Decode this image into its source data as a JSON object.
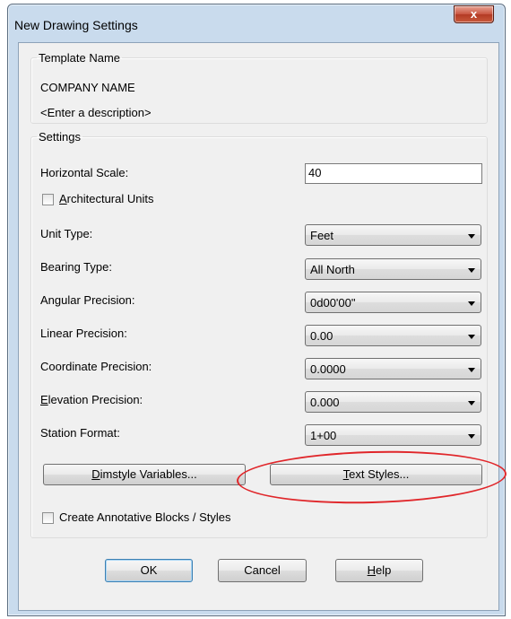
{
  "window": {
    "title": "New Drawing Settings",
    "close_glyph": "x"
  },
  "template_group": {
    "legend": "Template Name",
    "name": "COMPANY NAME",
    "description": "<Enter a description>"
  },
  "settings": {
    "legend": "Settings",
    "horizontal_scale": {
      "label": "Horizontal Scale:",
      "value": "40"
    },
    "architectural_units": {
      "label_prefix": "",
      "label_accel": "A",
      "label_rest": "rchitectural Units",
      "checked": false
    },
    "unit_type": {
      "label": "Unit Type:",
      "value": "Feet"
    },
    "bearing_type": {
      "label": "Bearing Type:",
      "value": "All North"
    },
    "angular_precision": {
      "label": "Angular Precision:",
      "value": "0d00'00\""
    },
    "linear_precision": {
      "label": "Linear Precision:",
      "value": "0.00"
    },
    "coordinate_precision": {
      "label": "Coordinate Precision:",
      "value": "0.0000"
    },
    "elevation_precision": {
      "label_accel": "E",
      "label_rest": "levation Precision:",
      "value": "0.000"
    },
    "station_format": {
      "label": "Station Format:",
      "value": "1+00"
    },
    "dimstyle_button": {
      "accel": "D",
      "rest": "imstyle Variables..."
    },
    "text_styles_button": {
      "accel": "T",
      "rest": "ext Styles..."
    },
    "annotative_checkbox": {
      "label": "Create Annotative Blocks / Styles",
      "checked": false
    }
  },
  "buttons": {
    "ok": "OK",
    "cancel": "Cancel",
    "help_accel": "H",
    "help_rest": "elp"
  },
  "colors": {
    "frame": "#c9dbed",
    "client": "#f0f0f0",
    "highlight": "#e0262a",
    "close_button": "#c8543f"
  }
}
